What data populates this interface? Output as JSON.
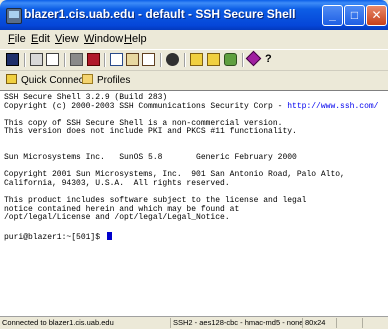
{
  "window": {
    "title": "blazer1.cis.uab.edu - default - SSH Secure Shell",
    "minimize_glyph": "_",
    "maximize_glyph": "□",
    "close_glyph": "✕"
  },
  "menu": {
    "items": [
      "File",
      "Edit",
      "View",
      "Window",
      "Help"
    ]
  },
  "toolbar": {
    "icons": [
      "save-icon",
      "print-icon",
      "print-preview-icon",
      "disconnect-icon",
      "settings-icon",
      "copy-icon",
      "paste-icon",
      "paste-selection-icon",
      "find-icon",
      "file-transfer-icon",
      "new-terminal-icon",
      "profiles-icon",
      "encrypt-icon",
      "help-icon"
    ]
  },
  "quickbar": {
    "quick_connect_label": "Quick Connect",
    "profiles_label": "Profiles"
  },
  "terminal": {
    "lines": [
      "SSH Secure Shell 3.2.9 (Build 283)",
      "Copyright (c) 2000-2003 SSH Communications Security Corp - ",
      "",
      "This copy of SSH Secure Shell is a non-commercial version.",
      "This version does not include PKI and PKCS #11 functionality.",
      "",
      "",
      "Sun Microsystems Inc.   SunOS 5.8       Generic February 2000",
      "",
      "Copyright 2001 Sun Microsystems, Inc.  901 San Antonio Road, Palo Alto,",
      "California, 94303, U.S.A.  All rights reserved.",
      "",
      "This product includes software subject to the license and legal",
      "notice contained herein and which may be found at",
      "/opt/legal/License and /opt/legal/Legal_Notice.",
      "",
      "puri@blazer1:~[501]$ "
    ],
    "link_text": "http://www.ssh.com/",
    "background": "#ffffff",
    "cursor_color": "#0000cc"
  },
  "status": {
    "connection": "Connected to blazer1.cis.uab.edu",
    "cipher": "SSH2 - aes128-cbc - hmac-md5 - none",
    "size": "80x24"
  },
  "colors": {
    "titlebar": "#0546d8",
    "chrome": "#ece9d8",
    "close_button": "#c5401c"
  }
}
